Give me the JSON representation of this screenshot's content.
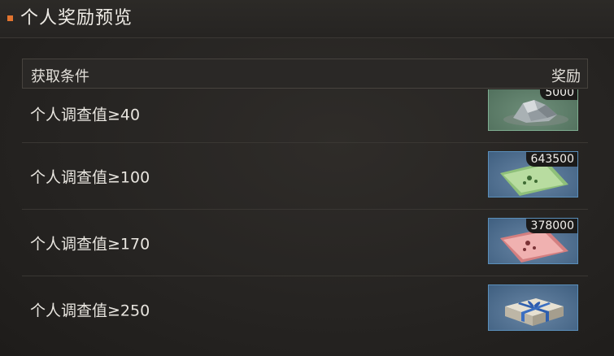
{
  "header": {
    "title": "个人奖励预览"
  },
  "table": {
    "col_condition": "获取条件",
    "col_reward": "奖励"
  },
  "rows": [
    {
      "condition": "个人调查值≥40",
      "reward": {
        "item": "silver-ore-icon",
        "quantity": "5000",
        "frame": "green"
      }
    },
    {
      "condition": "个人调查值≥100",
      "reward": {
        "item": "green-ticket-icon",
        "quantity": "643500",
        "frame": "blue"
      }
    },
    {
      "condition": "个人调查值≥170",
      "reward": {
        "item": "red-ticket-icon",
        "quantity": "378000",
        "frame": "blue"
      }
    },
    {
      "condition": "个人调查值≥250",
      "reward": {
        "item": "gift-box-icon",
        "quantity": "",
        "frame": "blue"
      }
    }
  ],
  "colors": {
    "accent": "#e2742f",
    "frame_blue": "#5a8fbb",
    "frame_green": "#7fae92"
  }
}
